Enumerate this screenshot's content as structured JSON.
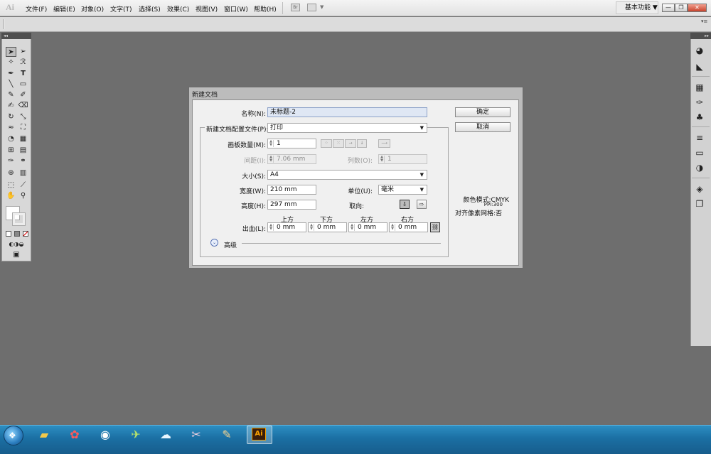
{
  "menubar": {
    "app_logo": "Ai",
    "items": [
      "文件(F)",
      "编辑(E)",
      "对象(O)",
      "文字(T)",
      "选择(S)",
      "效果(C)",
      "视图(V)",
      "窗口(W)",
      "帮助(H)"
    ],
    "bridge": "Br",
    "workspace": "基本功能 ▼"
  },
  "window_controls": {
    "minimize": "—",
    "restore": "❐",
    "close": "✕"
  },
  "dialog": {
    "title": "新建文档",
    "name_label": "名称(N):",
    "name_value": "未标题-2",
    "profile_label": "新建文档配置文件(P):",
    "profile_value": "打印",
    "artboards_label": "画板数量(M):",
    "artboards_value": "1",
    "spacing_label": "间距(I):",
    "spacing_value": "7.06 mm",
    "columns_label": "列数(O):",
    "columns_value": "1",
    "size_label": "大小(S):",
    "size_value": "A4",
    "width_label": "宽度(W):",
    "width_value": "210 mm",
    "units_label": "单位(U):",
    "units_value": "毫米",
    "height_label": "高度(H):",
    "height_value": "297 mm",
    "orientation_label": "取向:",
    "bleed_label": "出血(L):",
    "bleed_top_label": "上方",
    "bleed_bottom_label": "下方",
    "bleed_left_label": "左方",
    "bleed_right_label": "右方",
    "bleed_top": "0 mm",
    "bleed_bottom": "0 mm",
    "bleed_left": "0 mm",
    "bleed_right": "0 mm",
    "advanced_label": "高级",
    "ok_label": "确定",
    "cancel_label": "取消",
    "info_color_mode": "颜色模式:CMYK",
    "info_ppi": "PPI:300",
    "info_pixel_grid": "对齐像素网格:否"
  },
  "taskbar": {
    "icons": [
      "windows-start",
      "file-explorer",
      "color-wheel",
      "wifi",
      "lite-app",
      "cloud-app",
      "paint-tool",
      "palette-app",
      "illustrator"
    ],
    "active_app_label": "Ai"
  }
}
